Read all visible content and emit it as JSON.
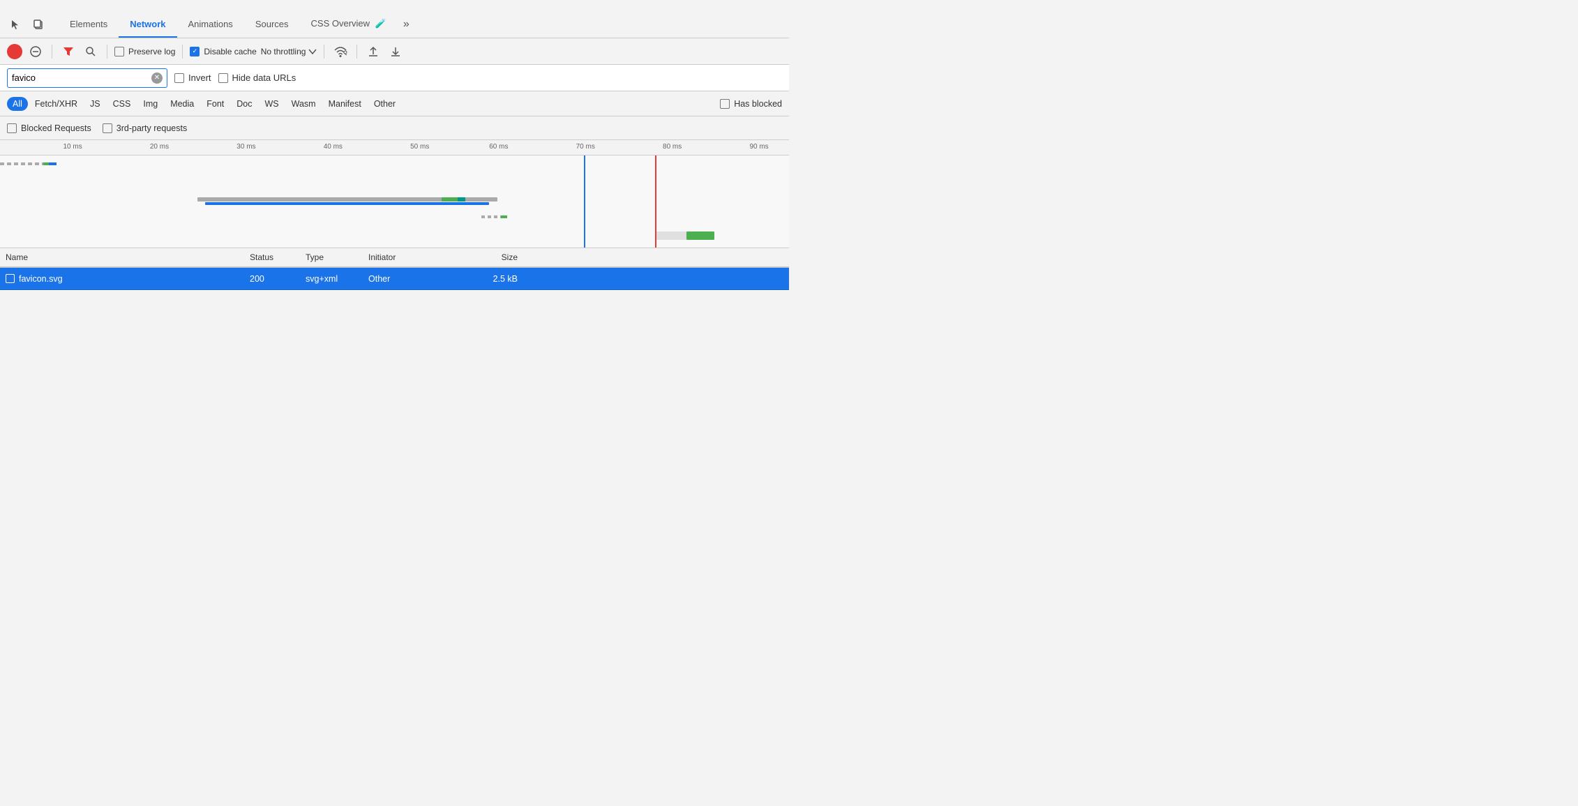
{
  "tabs": {
    "items": [
      {
        "label": "Elements",
        "active": false
      },
      {
        "label": "Network",
        "active": true
      },
      {
        "label": "Animations",
        "active": false
      },
      {
        "label": "Sources",
        "active": false
      },
      {
        "label": "CSS Overview",
        "active": false
      }
    ],
    "more_label": "»"
  },
  "toolbar": {
    "preserve_log_label": "Preserve log",
    "disable_cache_label": "Disable cache",
    "no_throttling_label": "No throttling",
    "disable_cache_checked": true
  },
  "filter": {
    "search_value": "favico",
    "search_placeholder": "Filter",
    "invert_label": "Invert",
    "hide_data_urls_label": "Hide data URLs"
  },
  "type_filters": {
    "items": [
      {
        "label": "All",
        "active": true
      },
      {
        "label": "Fetch/XHR",
        "active": false
      },
      {
        "label": "JS",
        "active": false
      },
      {
        "label": "CSS",
        "active": false
      },
      {
        "label": "Img",
        "active": false
      },
      {
        "label": "Media",
        "active": false
      },
      {
        "label": "Font",
        "active": false
      },
      {
        "label": "Doc",
        "active": false
      },
      {
        "label": "WS",
        "active": false
      },
      {
        "label": "Wasm",
        "active": false
      },
      {
        "label": "Manifest",
        "active": false
      },
      {
        "label": "Other",
        "active": false
      }
    ],
    "has_blocked_label": "Has blocked"
  },
  "extra_filters": {
    "blocked_requests_label": "Blocked Requests",
    "third_party_label": "3rd-party requests"
  },
  "timeline": {
    "ruler_marks": [
      {
        "label": "10 ms",
        "left_pct": 8
      },
      {
        "label": "20 ms",
        "left_pct": 19
      },
      {
        "label": "30 ms",
        "left_pct": 30
      },
      {
        "label": "40 ms",
        "left_pct": 41
      },
      {
        "label": "50 ms",
        "left_pct": 52
      },
      {
        "label": "60 ms",
        "left_pct": 63
      },
      {
        "label": "70 ms",
        "left_pct": 74
      },
      {
        "label": "80 ms",
        "left_pct": 85
      },
      {
        "label": "90 ms",
        "left_pct": 96
      }
    ]
  },
  "table": {
    "headers": {
      "name": "Name",
      "status": "Status",
      "type": "Type",
      "initiator": "Initiator",
      "size": "Size"
    },
    "rows": [
      {
        "name": "favicon.svg",
        "status": "200",
        "type": "svg+xml",
        "initiator": "Other",
        "size": "2.5 kB"
      }
    ]
  }
}
